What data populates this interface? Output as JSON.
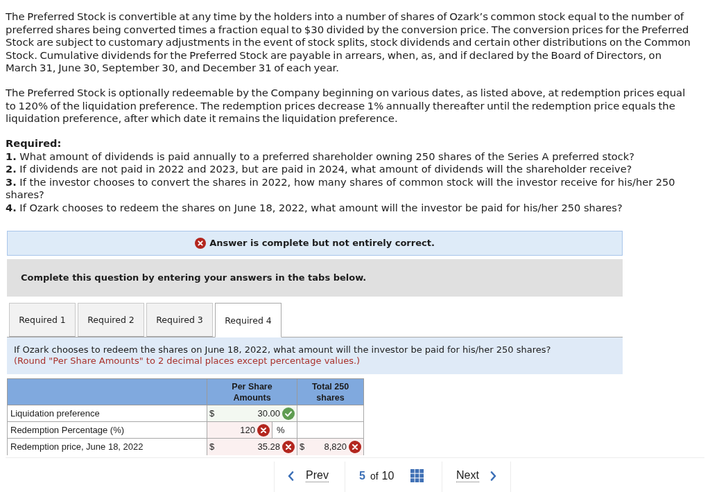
{
  "intro_paragraphs": [
    "The Preferred Stock is convertible at any time by the holders into a number of shares of Ozark’s common stock equal to the number of preferred shares being converted times a fraction equal to $30 divided by the conversion price. The conversion prices for the Preferred Stock are subject to customary adjustments in the event of stock splits, stock dividends and certain other distributions on the Common Stock. Cumulative dividends for the Preferred Stock are payable in arrears, when, as, and if declared by the Board of Directors, on March 31, June 30, September 30, and December 31 of each year.",
    "The Preferred Stock is optionally redeemable by the Company beginning on various dates, as listed above, at redemption prices equal to 120% of the liquidation preference. The redemption prices decrease 1% annually thereafter until the redemption price equals the liquidation preference, after which date it remains the liquidation preference."
  ],
  "required": {
    "heading": "Required:",
    "items": [
      "**1.** What amount of dividends is paid annually to a preferred shareholder owning 250 shares of the Series A preferred stock?",
      "**2.** If dividends are not paid in 2022 and 2023, but are paid in 2024, what amount of dividends will the shareholder receive?",
      "**3.** If the investor chooses to convert the shares in 2022, how many shares of common stock will the investor receive for his/her 250 shares?",
      "**4.** If Ozark chooses to redeem the shares on June 18, 2022, what amount will the investor be paid for his/her 250 shares?"
    ]
  },
  "feedback": {
    "correct": false,
    "text": "Answer is complete but not entirely correct."
  },
  "instruction": "Complete this question by entering your answers in the tabs below.",
  "tabs": [
    {
      "label": "Required 1",
      "selected": false
    },
    {
      "label": "Required 2",
      "selected": false
    },
    {
      "label": "Required 3",
      "selected": false
    },
    {
      "label": "Required 4",
      "selected": true
    }
  ],
  "question": {
    "text": "If Ozark chooses to redeem the shares on June 18, 2022, what amount will the investor be paid for his/her 250 shares?",
    "note": "(Round \"Per Share Amounts\" to 2 decimal places except percentage values.)"
  },
  "table": {
    "columns": [
      "Per Share Amounts",
      "Total 250 shares"
    ],
    "rows": [
      {
        "label": "Liquidation preference",
        "per_share": {
          "prefix": "$",
          "value": "30.00",
          "correct": true
        }
      },
      {
        "label": "Redemption Percentage (%)",
        "per_share": {
          "value": "120",
          "correct": false,
          "unit": "%"
        }
      },
      {
        "label": "Redemption price, June 18, 2022",
        "per_share": {
          "prefix": "$",
          "value": "35.28",
          "correct": false
        },
        "total": {
          "prefix": "$",
          "value": "8,820",
          "correct": false
        }
      }
    ]
  },
  "pagination": {
    "prev": "Prev",
    "current": "5",
    "of": "of",
    "total": "10",
    "next": "Next"
  }
}
